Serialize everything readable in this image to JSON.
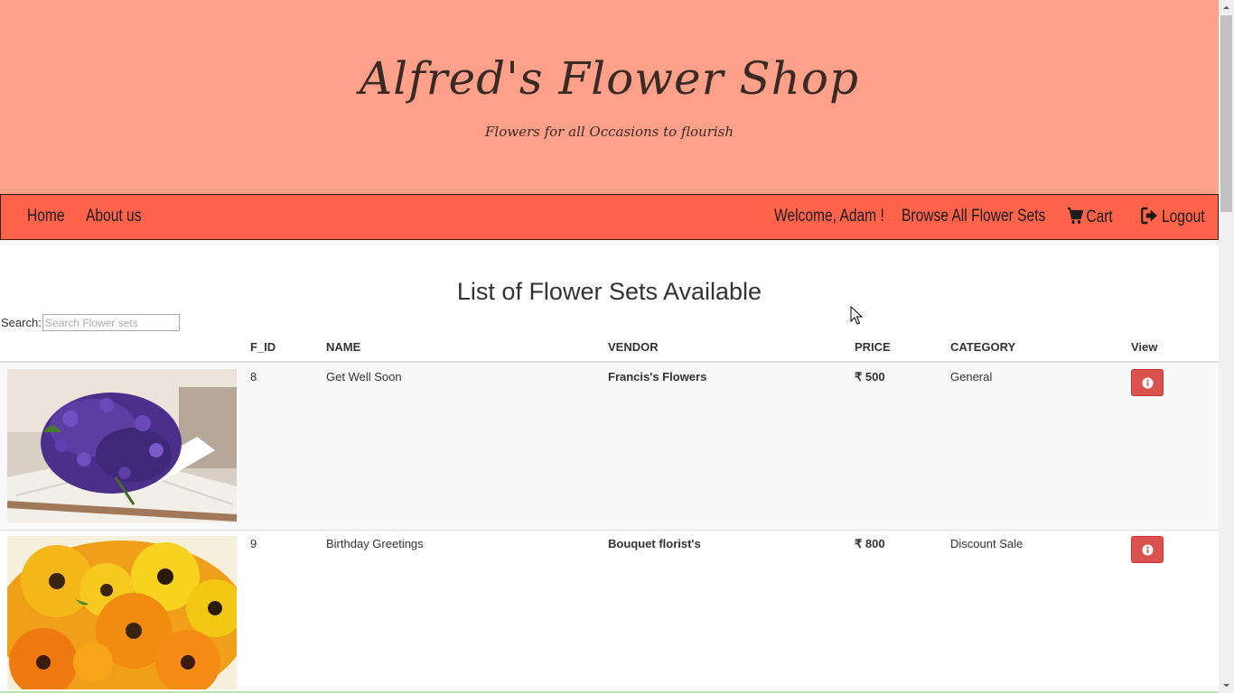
{
  "header": {
    "title": "Alfred's Flower Shop",
    "tagline": "Flowers for all Occasions to flourish"
  },
  "nav": {
    "home": "Home",
    "about": "About us",
    "welcome": "Welcome, Adam !",
    "browse": "Browse All Flower Sets",
    "cart": "Cart",
    "logout": "Logout"
  },
  "main": {
    "title": "List of Flower Sets Available",
    "search_label": "Search:",
    "search_placeholder": "Search Flower sets",
    "columns": [
      "F_ID",
      "NAME",
      "VENDOR",
      "PRICE",
      "CATEGORY",
      "View"
    ]
  },
  "rows": [
    {
      "id": "8",
      "name": "Get Well Soon",
      "vendor": "Francis's Flowers",
      "price": "₹ 500",
      "category": "General"
    },
    {
      "id": "9",
      "name": "Birthday Greetings",
      "vendor": "Bouquet florist's",
      "price": "₹ 800",
      "category": "Discount Sale"
    }
  ],
  "colors": {
    "header_bg": "#ffa08a",
    "navbar_bg": "#ff634a",
    "button_bg": "#d9534f"
  }
}
